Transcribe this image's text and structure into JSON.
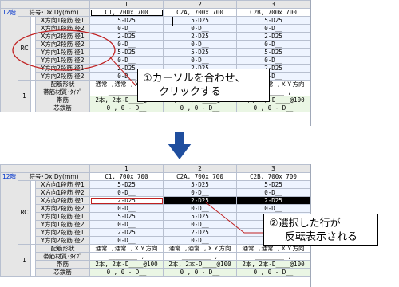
{
  "grid": {
    "columns": [
      "1",
      "2",
      "3"
    ],
    "floor_label": "12階",
    "section_label": "RC",
    "row_number": "1",
    "header_label": "符号･Dx Dy(mm)",
    "names": [
      "C1, 700x 700",
      "C2A, 700x 700",
      "C2B, 700x 700"
    ],
    "row_labels": [
      "X方向1段筋 径1",
      "X方向1段筋 径2",
      "X方向2段筋 径1",
      "X方向2段筋 径2",
      "Y方向1段筋 径1",
      "Y方向1段筋 径2",
      "Y方向2段筋 径1",
      "Y方向2段筋 径2",
      "配筋形状",
      "帯筋材質･ﾀｲﾌﾟ",
      "帯筋",
      "芯鉄筋"
    ],
    "rows": [
      [
        "5-D25",
        "5-D25",
        "5-D25"
      ],
      [
        "0-D__",
        "0-D__",
        "0-D__"
      ],
      [
        "2-D25",
        "2-D25",
        "2-D25"
      ],
      [
        "0-D__",
        "0-D__",
        "0-D__"
      ],
      [
        "5-D25",
        "5-D25",
        "5-D25"
      ],
      [
        "0-D__",
        "0-D__",
        "0-D__"
      ],
      [
        "2-D25",
        "2-D25",
        "2-D25"
      ],
      [
        "0-D__",
        "0-D__",
        "0-D__"
      ],
      [
        "通常 ,通常 ,ＸＹ方向",
        "通常 ,通常 ,ＸＹ方向",
        "通常 ,通常 ,ＸＹ方向"
      ],
      [
        "________ ,",
        "________ ,",
        "________ ,"
      ],
      [
        "2本, 2本-D____@100",
        "2本, 2本-D____@100",
        "2本, 2本-D____@100"
      ],
      [
        "0 , 0 - D__",
        "0 , 0 - D__",
        "0 , 0 - D__"
      ]
    ]
  },
  "callout_1": {
    "line1": "①カーソルを合わせ、",
    "line2": "クリックする"
  },
  "callout_2": {
    "line1": "②選択した行が",
    "line2": "反転表示される"
  },
  "colors": {
    "selected_row": "#000000",
    "arrow": "#1f4e9e",
    "annotation": "#c02020"
  }
}
